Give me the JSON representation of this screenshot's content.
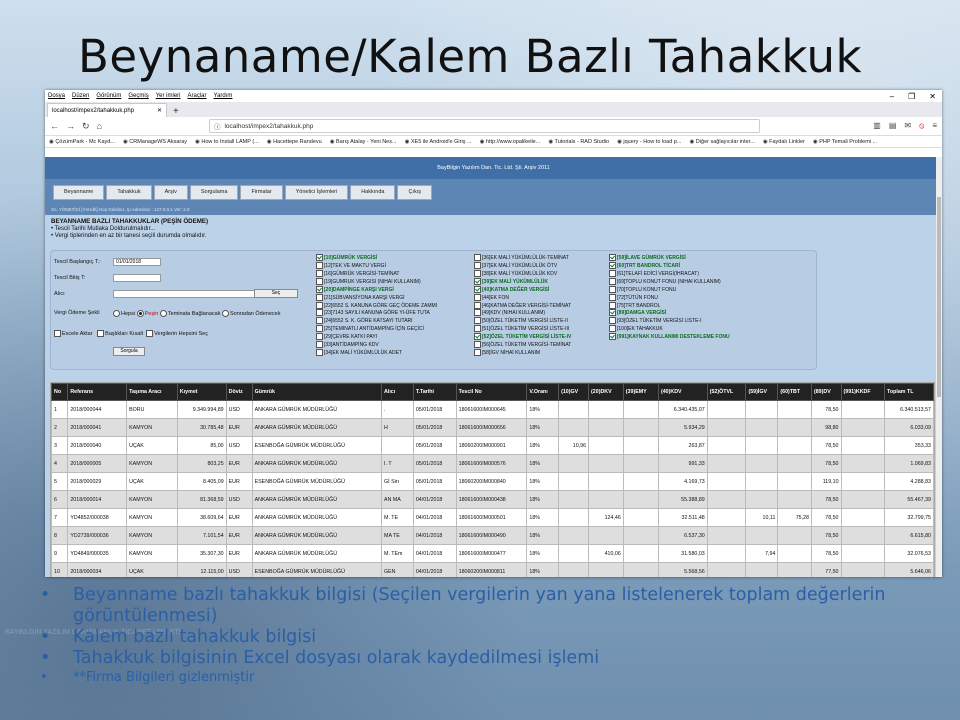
{
  "slide": {
    "title": "Beynaname/Kalem Bazlı Tahakkuk",
    "bullets": [
      "Beyanname bazlı tahakkuk bilgisi (Seçilen vergilerin yan yana listelenerek toplam değerlerin görüntülenmesi)",
      "Kalem bazlı tahakkuk bilgisi",
      "Tahakkuk bilgisinin Excel dosyası olarak kaydedilmesi işlemi",
      "**Firma Bilgileri gizlenmiştir"
    ],
    "footer_ghost": "BAYBILGIN YAZILIM DANIŞMANLIK TİCARET LTD. ŞTİ."
  },
  "browser": {
    "menu": [
      "Dosya",
      "Düzen",
      "Görünüm",
      "Geçmiş",
      "Yer imleri",
      "Araçlar",
      "Yardım"
    ],
    "tab_title": "localhost/impex2/tahakkuk.php",
    "url": "localhost/impex2/tahakkuk.php",
    "bookmarks": [
      "ÇözümPark - Mc Kayd...",
      "CRManageWS Aksaray",
      "How to Install LAMP (...",
      "Hacettepe Randevu",
      "Barış Atalay - Yeni Nes...",
      "XE5 ile Android'e Giriş ...",
      "http://www.opalikeile...",
      "Tutorials - RAD Studio",
      "jquery - How to load p...",
      "Diğer sağlayıcılar inter...",
      "Faydalı Linkler",
      "PHP Temali Problemi ..."
    ]
  },
  "app": {
    "header": "BayBilgin Yazılım Dan. Tic. Ltd. Şti. Arşiv 2011",
    "nav": [
      "Beyanname",
      "Tahakkuk",
      "Arşiv",
      "Sorgulama",
      "Firmalar",
      "Yönetici İşlemleri",
      "Hakkında",
      "Çıkış"
    ],
    "info_strip": "Sn. YÖNETİCİ [YnHdh] Hoş Geldiniz, Ip Adresiniz : 127.0.0.1 Ver: 2.0",
    "section_title": "BEYANNAME BAZLI TAHAKKUKLAR (PEŞİN ÖDEME)",
    "notes": [
      "• Tescil Tarihi Mutlaka Doldurulmalıdır...",
      "• Vergi tiplerinden en az bir tanesi seçili durumda olmalıdır."
    ],
    "filters": {
      "start_label": "Tescil Başlangıç T.:",
      "start_value": "01/01/2018",
      "end_label": "Tescil Bitiş T:",
      "buyer_label": "Alıcı",
      "select_btn": "Seç",
      "pay_label": "Vergi Ödeme Şekli",
      "pay_options": [
        "Hepsi",
        "Peşin",
        "Teminata Bağlanacak",
        "Sonradan Ödenecek"
      ],
      "opt_excel": "Excele Aktar",
      "opt_hide_headers": "Başlıkları Kısalt",
      "opt_select_all": "Vergilerin Hepsini Seç",
      "query_btn": "Sorgula"
    },
    "tax_col1": [
      {
        "t": "[10]GÜMRÜK VERGİSİ",
        "on": true
      },
      {
        "t": "[12]TEK VE MAKTU VERGİ",
        "on": false
      },
      {
        "t": "[16]GÜMRÜK VERGİSİ-TEMİNAT",
        "on": false
      },
      {
        "t": "[19]GUMRUK VERGISI (NIHAI KULLANIM)",
        "on": false
      },
      {
        "t": "[20]DAMPİNGE KARŞI VERGİ",
        "on": true
      },
      {
        "t": "[21]SÜBVANSİYONA KARŞI VERGİ",
        "on": false
      },
      {
        "t": "[22]6552 S. KANUNA GÖRE GEÇ ÖDEME ZAMMI",
        "on": false
      },
      {
        "t": "[23]7143 SAYILI KANUNA GÖRE YI-ÜFE TUTA",
        "on": false
      },
      {
        "t": "[24]6552 S. K. GÖRE KATSAYI TUTARI",
        "on": false
      },
      {
        "t": "[25]TEMINATLI ANTİDAMPİNG İÇİN GEÇİCİ",
        "on": false
      },
      {
        "t": "[29]ÇEVRE KATKI PAYI",
        "on": false
      },
      {
        "t": "[33]ANTİDAMPİNG KDV",
        "on": false
      },
      {
        "t": "[34]EK MALİ YÜKÜMLÜLÜK ADET",
        "on": false
      }
    ],
    "tax_col2": [
      {
        "t": "[36]EK MALİ YÜKÜMLÜLÜK-TEMİNAT",
        "on": false
      },
      {
        "t": "[37]EK MALİ YÜKÜMLÜLÜK ÖTV",
        "on": false
      },
      {
        "t": "[38]EK MALİ YÜKÜMLÜLÜK KDV",
        "on": false
      },
      {
        "t": "[39]EK MALİ YÜKÜMLÜLÜK",
        "on": true
      },
      {
        "t": "[40]KATMA DEĞER VERGİSİ",
        "on": true
      },
      {
        "t": "[44]EK FON",
        "on": false
      },
      {
        "t": "[46]KATMA DEĞER VERGİSİ-TEMİNAT",
        "on": false
      },
      {
        "t": "[49]KDV (NIHAI KULLANIM)",
        "on": false
      },
      {
        "t": "[50]ÖZEL TÜKETİM VERGİSİ LİSTE-II",
        "on": false
      },
      {
        "t": "[51]ÖZEL TÜKETİM VERGİSİ LİSTE-III",
        "on": false
      },
      {
        "t": "[52]ÖZEL TÜKETİM VERGİSİ LİSTE-IV",
        "on": true
      },
      {
        "t": "[56]ÖZEL TÜKETİM VERGİSİ-TEMİNAT",
        "on": false
      },
      {
        "t": "[58]İGV NİHAİ KULLANIM",
        "on": false
      }
    ],
    "tax_col3": [
      {
        "t": "[59]İLAVE GÜMRÜK VERGİSİ",
        "on": true
      },
      {
        "t": "[60]TRT BANDROL TİCARİ",
        "on": true
      },
      {
        "t": "[61]TELAFİ EDİCİ VERGİ(İHRACAT)",
        "on": false
      },
      {
        "t": "[69]TOPLU KONUT FONU (NIHAI KULLANIM)",
        "on": false
      },
      {
        "t": "[70]TOPLU KONUT FONU",
        "on": false
      },
      {
        "t": "[72]TÜTÜN FONU",
        "on": false
      },
      {
        "t": "[75]TRT BANDROL",
        "on": false
      },
      {
        "t": "[89]DAMGA VERGİSİ",
        "on": true
      },
      {
        "t": "[93]ÖZEL TÜKETİM VERGİSİ LİSTE-I",
        "on": false
      },
      {
        "t": "[100]EK TAHAKKUK",
        "on": false
      },
      {
        "t": "[991]KAYNAK KULLANIMI DESTEKLEME FONU",
        "on": true
      }
    ],
    "table": {
      "headers": [
        "No",
        "Referans",
        "Taşıma Aracı",
        "Kıymet",
        "Döviz",
        "Gümrük",
        "Alıcı",
        "T.Tarihi",
        "Tescil No",
        "V.Oranı",
        "(10)GV",
        "(20)DKV",
        "(39)EMY",
        "(40)KDV",
        "(52)ÖTVL",
        "(59)İGV",
        "(60)TBT",
        "(89)DV",
        "(991)KKDF",
        "Toplam TL"
      ],
      "rows": [
        [
          "1",
          "2018/000044",
          "BORU",
          "9.349.994,89",
          "USD",
          "ANKARA GÜMRÜK MÜDÜRLÜĞÜ",
          ".",
          "05/01/2018",
          "18061600IM000645",
          "18%",
          "",
          "",
          "",
          "6.340.435,07",
          "",
          "",
          "",
          "78,50",
          "",
          "6.340.513,57"
        ],
        [
          "2",
          "2018/000041",
          "KAMYON",
          "30.785,48",
          "EUR",
          "ANKARA GÜMRÜK MÜDÜRLÜĞÜ",
          "H",
          "05/01/2018",
          "18061600IM000656",
          "18%",
          "",
          "",
          "",
          "5.934,29",
          "",
          "",
          "",
          "98,80",
          "",
          "6.033,09"
        ],
        [
          "3",
          "2018/000040",
          "UÇAK",
          "85,00",
          "USD",
          "ESENBOĞA GÜMRÜK MÜDÜRLÜĞÜ",
          "",
          "05/01/2018",
          "18060200IM000901",
          "18%",
          "10,96",
          "",
          "",
          "263,87",
          "",
          "",
          "",
          "78,50",
          "",
          "353,33"
        ],
        [
          "4",
          "2018/000005",
          "KAMYON",
          "803,25",
          "EUR",
          "ANKARA GÜMRÜK MÜDÜRLÜĞÜ",
          "I. T",
          "05/01/2018",
          "18061600IM000576",
          "18%",
          "",
          "",
          "",
          "991,33",
          "",
          "",
          "",
          "78,50",
          "",
          "1.069,83"
        ],
        [
          "5",
          "2018/000029",
          "UÇAK",
          "8.405,09",
          "EUR",
          "ESENBOĞA GÜMRÜK MÜDÜRLÜĞÜ",
          "Gİ Sirı",
          "05/01/2018",
          "18060200IM000840",
          "18%",
          "",
          "",
          "",
          "4.169,73",
          "",
          "",
          "",
          "119,10",
          "",
          "4.288,83"
        ],
        [
          "6",
          "2018/000014",
          "KAMYON",
          "81.368,59",
          "USD",
          "ANKARA GÜMRÜK MÜDÜRLÜĞÜ",
          "AN MA",
          "04/01/2018",
          "18061600IM000438",
          "18%",
          "",
          "",
          "",
          "55.388,89",
          "",
          "",
          "",
          "78,50",
          "",
          "55.467,39"
        ],
        [
          "7",
          "YD4852/000038",
          "KAMYON",
          "38.609,64",
          "EUR",
          "ANKARA GÜMRÜK MÜDÜRLÜĞÜ",
          "M. TE",
          "04/01/2018",
          "18061600IM000501",
          "18%",
          "",
          "124,46",
          "",
          "32.511,48",
          "",
          "10,11",
          "75,28",
          "78,50",
          "",
          "32.799,75"
        ],
        [
          "8",
          "YD2739/000036",
          "KAMYON",
          "7.101,54",
          "EUR",
          "ANKARA GÜMRÜK MÜDÜRLÜĞÜ",
          "MA TE",
          "04/01/2018",
          "18061600IM000490",
          "18%",
          "",
          "",
          "",
          "6.537,30",
          "",
          "",
          "",
          "78,50",
          "",
          "6.615,80"
        ],
        [
          "9",
          "YD4849/000035",
          "KAMYON",
          "35.307,30",
          "EUR",
          "ANKARA GÜMRÜK MÜDÜRLÜĞÜ",
          "M. TEm",
          "04/01/2018",
          "18061600IM000477",
          "18%",
          "",
          "410,06",
          "",
          "31.580,03",
          "",
          "7,94",
          "",
          "78,50",
          "",
          "32.076,53"
        ],
        [
          "10",
          "2018/000034",
          "UÇAK",
          "12.115,00",
          "USD",
          "ESENBOĞA GÜMRÜK MÜDÜRLÜĞÜ",
          "GEN",
          "04/01/2018",
          "18060200IM000811",
          "18%",
          "",
          "",
          "",
          "5.568,56",
          "",
          "",
          "",
          "77,50",
          "",
          "5.646,06"
        ]
      ]
    }
  }
}
